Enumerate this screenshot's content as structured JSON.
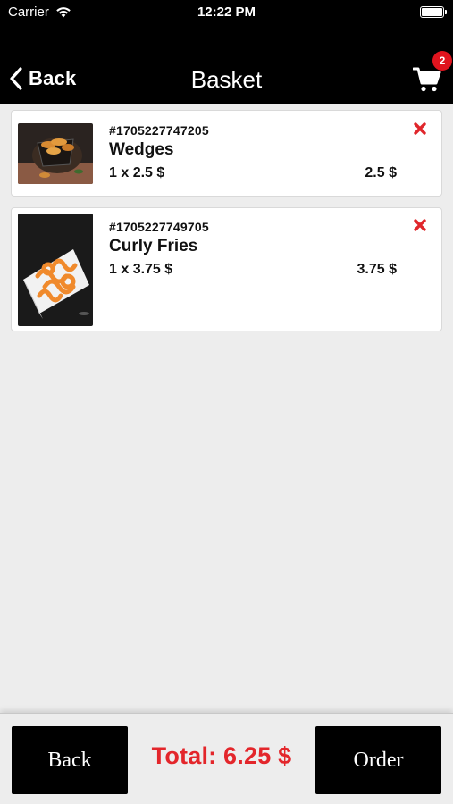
{
  "status_bar": {
    "carrier": "Carrier",
    "time": "12:22 PM",
    "wifi_icon": "wifi-icon",
    "battery_icon": "battery-icon"
  },
  "nav": {
    "back_label": "Back",
    "title": "Basket",
    "cart_icon": "cart-icon",
    "cart_count": "2"
  },
  "items": [
    {
      "order_id": "#1705227747205",
      "name": "Wedges",
      "quantity_price": "1 x 2.5 $",
      "line_total": "2.5 $",
      "image": "wedges-photo",
      "remove_icon": "remove-icon"
    },
    {
      "order_id": "#1705227749705",
      "name": "Curly Fries",
      "quantity_price": "1 x 3.75 $",
      "line_total": "3.75 $",
      "image": "curly-fries-photo",
      "remove_icon": "remove-icon"
    }
  ],
  "footer": {
    "back_label": "Back",
    "total_text": "Total: 6.25 $",
    "order_label": "Order"
  },
  "colors": {
    "header_bg": "#000000",
    "page_bg": "#ededed",
    "accent_red": "#e3262b",
    "button_bg": "#000000"
  }
}
